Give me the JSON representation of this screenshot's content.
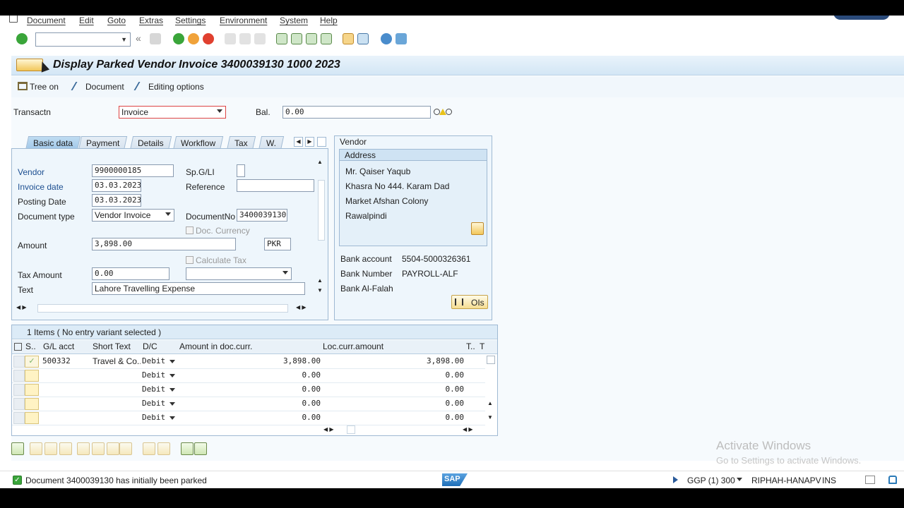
{
  "menu": [
    "Document",
    "Edit",
    "Goto",
    "Extras",
    "Settings",
    "Environment",
    "System",
    "Help"
  ],
  "title": "Display Parked Vendor Invoice 3400039130 1000 2023",
  "app_toolbar": {
    "tree_on": "Tree on",
    "document": "Document",
    "editing_options": "Editing options"
  },
  "header": {
    "transactn_label": "Transactn",
    "transactn_value": "Invoice",
    "bal_label": "Bal.",
    "bal_value": "0.00"
  },
  "tabs": [
    "Basic data",
    "Payment",
    "Details",
    "Workflow",
    "Tax",
    "W."
  ],
  "basic_data": {
    "vendor_label": "Vendor",
    "vendor_value": "9900000185",
    "invoice_date_label": "Invoice date",
    "invoice_date_value": "03.03.2023",
    "posting_date_label": "Posting Date",
    "posting_date_value": "03.03.2023",
    "doc_type_label": "Document type",
    "doc_type_value": "Vendor Invoice",
    "spgl_label": "Sp.G/LI",
    "reference_label": "Reference",
    "docno_label": "DocumentNo",
    "docno_value": "3400039130",
    "doc_currency_label": "Doc. Currency",
    "amount_label": "Amount",
    "amount_value": "3,898.00",
    "currency_value": "PKR",
    "calc_tax_label": "Calculate Tax",
    "tax_amount_label": "Tax Amount",
    "tax_amount_value": "0.00",
    "text_label": "Text",
    "text_value": "Lahore Travelling Expense"
  },
  "vendor_panel": {
    "title": "Vendor",
    "address_title": "Address",
    "address_lines": [
      "Mr. Qaiser Yaqub",
      "Khasra No 444. Karam Dad",
      "Market Afshan Colony",
      "Rawalpindi"
    ],
    "bank_account_label": "Bank account",
    "bank_account_value": "5504-5000326361",
    "bank_number_label": "Bank Number",
    "bank_number_value": "PAYROLL-ALF",
    "bank_name": "Bank Al-Falah",
    "ois_button": "OIs"
  },
  "items": {
    "header": "1 Items ( No entry variant selected )",
    "columns": [
      "S..",
      "G/L acct",
      "Short Text",
      "D/C",
      "Amount in doc.curr.",
      "Loc.curr.amount",
      "T..",
      "T"
    ],
    "rows": [
      {
        "gl": "500332",
        "short_text": "Travel & Co...",
        "dc": "Debit",
        "amount": "3,898.00",
        "loc_amount": "3,898.00"
      },
      {
        "gl": "",
        "short_text": "",
        "dc": "Debit",
        "amount": "0.00",
        "loc_amount": "0.00"
      },
      {
        "gl": "",
        "short_text": "",
        "dc": "Debit",
        "amount": "0.00",
        "loc_amount": "0.00"
      },
      {
        "gl": "",
        "short_text": "",
        "dc": "Debit",
        "amount": "0.00",
        "loc_amount": "0.00"
      },
      {
        "gl": "",
        "short_text": "",
        "dc": "Debit",
        "amount": "0.00",
        "loc_amount": "0.00"
      }
    ]
  },
  "status": {
    "message": "Document 3400039130 has initially been parked",
    "system": "GGP (1) 300",
    "server": "RIPHAH-HANAPV",
    "mode": "INS",
    "sap_logo": "SAP"
  },
  "watermark": {
    "line1": "Activate Windows",
    "line2": "Go to Settings to activate Windows."
  }
}
